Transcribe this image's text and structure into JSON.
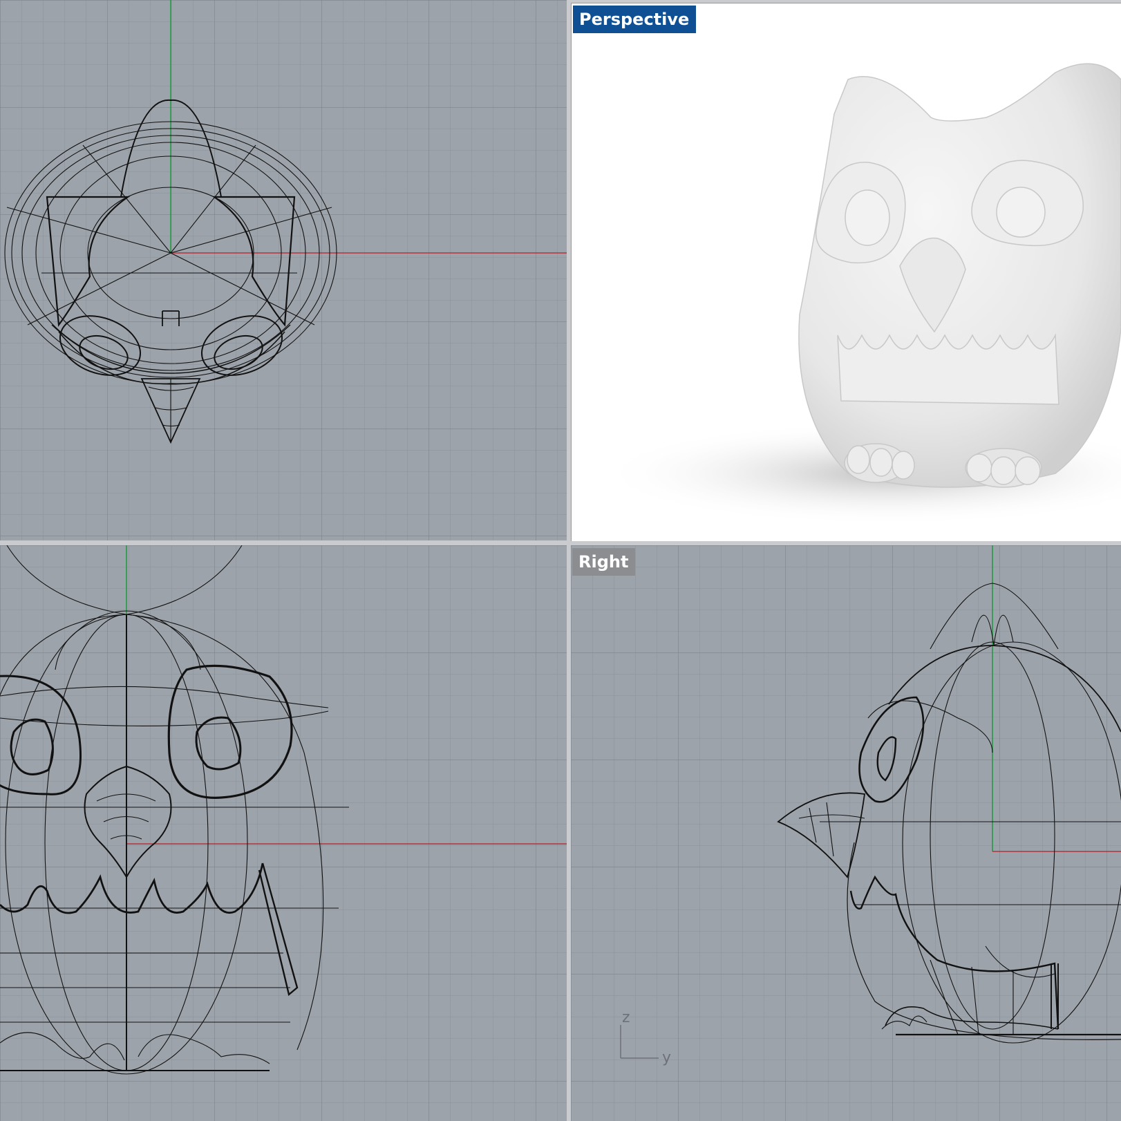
{
  "viewports": {
    "perspective": {
      "label": "Perspective",
      "label_bg": "#0f4f94",
      "active": true
    },
    "right": {
      "label": "Right",
      "label_bg": "#8b8d90"
    }
  },
  "axis_gizmo": {
    "vertical": "z",
    "horizontal": "y"
  },
  "colors": {
    "grid_bg": "#9da3aa",
    "grid_line": "#8f959c",
    "grid_major": "#858b92",
    "x_axis": "#b3333a",
    "y_axis": "#1a9a3b",
    "wire": "#111111",
    "separator": "#c9cbce"
  },
  "icons": [
    "xyz-axis-gizmo-icon"
  ]
}
